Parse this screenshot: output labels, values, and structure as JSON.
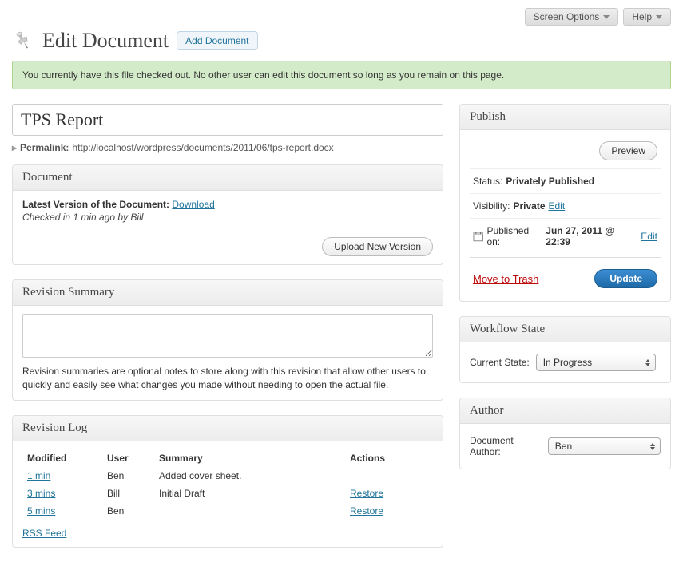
{
  "topbar": {
    "screen_options": "Screen Options",
    "help": "Help"
  },
  "header": {
    "title": "Edit Document",
    "add_new": "Add Document"
  },
  "notice": "You currently have this file checked out. No other user can edit this document so long as you remain on this page.",
  "post": {
    "title_value": "TPS Report",
    "permalink_label": "Permalink:",
    "permalink_url": "http://localhost/wordpress/documents/2011/06/tps-report.docx"
  },
  "document_box": {
    "heading": "Document",
    "latest_label": "Latest Version of the Document:",
    "download": "Download",
    "checked_in": "Checked in 1 min ago by Bill",
    "upload_btn": "Upload New Version"
  },
  "revision_summary_box": {
    "heading": "Revision Summary",
    "value": "",
    "help": "Revision summaries are optional notes to store along with this revision that allow other users to quickly and easily see what changes you made without needing to open the actual file."
  },
  "revision_log_box": {
    "heading": "Revision Log",
    "columns": {
      "modified": "Modified",
      "user": "User",
      "summary": "Summary",
      "actions": "Actions"
    },
    "rows": [
      {
        "modified": "1 min",
        "user": "Ben",
        "summary": "Added cover sheet.",
        "action": ""
      },
      {
        "modified": "3 mins",
        "user": "Bill",
        "summary": "Initial Draft",
        "action": "Restore"
      },
      {
        "modified": "5 mins",
        "user": "Ben",
        "summary": "",
        "action": "Restore"
      }
    ],
    "rss": "RSS Feed"
  },
  "publish_box": {
    "heading": "Publish",
    "preview": "Preview",
    "status_label": "Status:",
    "status_value": "Privately Published",
    "visibility_label": "Visibility:",
    "visibility_value": "Private",
    "visibility_edit": "Edit",
    "published_label": "Published on:",
    "published_value": "Jun 27, 2011 @ 22:39",
    "published_edit": "Edit",
    "trash": "Move to Trash",
    "update": "Update"
  },
  "workflow_box": {
    "heading": "Workflow State",
    "label": "Current State:",
    "value": "In Progress"
  },
  "author_box": {
    "heading": "Author",
    "label": "Document Author:",
    "value": "Ben"
  }
}
